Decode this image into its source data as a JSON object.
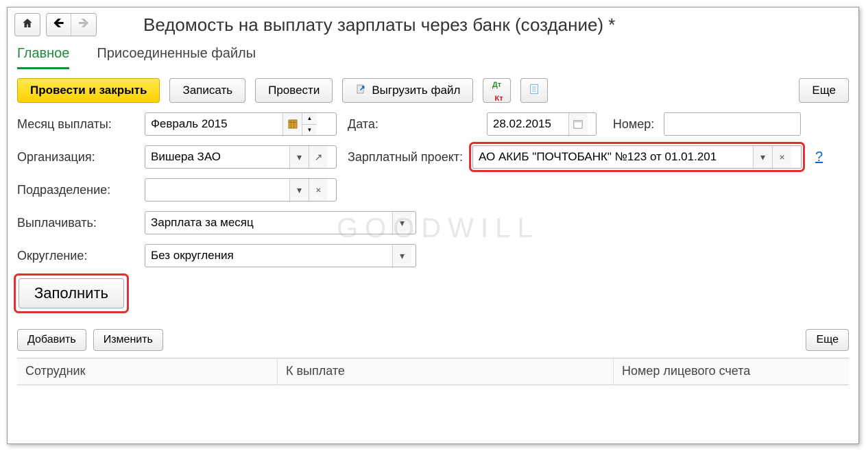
{
  "header": {
    "title": "Ведомость на выплату зарплаты через банк (создание) *"
  },
  "tabs": {
    "main": "Главное",
    "files": "Присоединенные файлы"
  },
  "toolbar": {
    "post_close": "Провести и закрыть",
    "save": "Записать",
    "post": "Провести",
    "export": "Выгрузить файл",
    "more": "Еще"
  },
  "form": {
    "month_label": "Месяц выплаты:",
    "month_value": "Февраль 2015",
    "date_label": "Дата:",
    "date_value": "28.02.2015",
    "number_label": "Номер:",
    "number_value": "",
    "org_label": "Организация:",
    "org_value": "Вишера ЗАО",
    "project_label": "Зарплатный проект:",
    "project_value": "АО АКИБ \"ПОЧТОБАНК\" №123 от 01.01.201",
    "dept_label": "Подразделение:",
    "dept_value": "",
    "pay_label": "Выплачивать:",
    "pay_value": "Зарплата за месяц",
    "round_label": "Округление:",
    "round_value": "Без округления",
    "fill": "Заполнить"
  },
  "subtoolbar": {
    "add": "Добавить",
    "edit": "Изменить",
    "more": "Еще"
  },
  "table": {
    "col_employee": "Сотрудник",
    "col_amount": "К выплате",
    "col_account": "Номер лицевого счета"
  },
  "help": "?",
  "watermark": "GOODWILL"
}
